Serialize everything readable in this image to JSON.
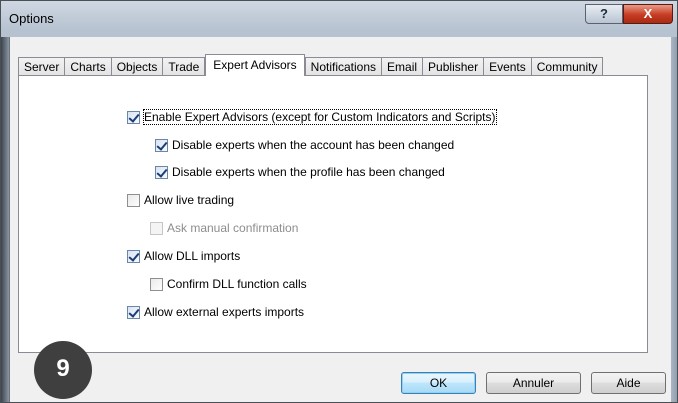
{
  "window": {
    "title": "Options"
  },
  "titlebar": {
    "help_label": "?",
    "close_label": "X"
  },
  "tabs": [
    {
      "label": "Server"
    },
    {
      "label": "Charts"
    },
    {
      "label": "Objects"
    },
    {
      "label": "Trade"
    },
    {
      "label": "Expert Advisors",
      "active": true
    },
    {
      "label": "Notifications"
    },
    {
      "label": "Email"
    },
    {
      "label": "Publisher"
    },
    {
      "label": "Events"
    },
    {
      "label": "Community"
    }
  ],
  "options": {
    "enable_experts": {
      "label": "Enable Expert Advisors (except for Custom Indicators and Scripts)",
      "checked": true
    },
    "disable_account_change": {
      "label": "Disable experts when the account has been changed",
      "checked": true
    },
    "disable_profile_change": {
      "label": "Disable experts when the profile has been changed",
      "checked": true
    },
    "allow_live_trading": {
      "label": "Allow live trading",
      "checked": false
    },
    "ask_manual_confirmation": {
      "label": "Ask manual confirmation",
      "checked": false,
      "disabled": true
    },
    "allow_dll_imports": {
      "label": "Allow DLL imports",
      "checked": true
    },
    "confirm_dll_calls": {
      "label": "Confirm DLL function calls",
      "checked": false
    },
    "allow_external_imports": {
      "label": "Allow external experts imports",
      "checked": true
    }
  },
  "buttons": {
    "ok": "OK",
    "cancel": "Annuler",
    "help": "Aide"
  },
  "badge": {
    "number": "9"
  }
}
